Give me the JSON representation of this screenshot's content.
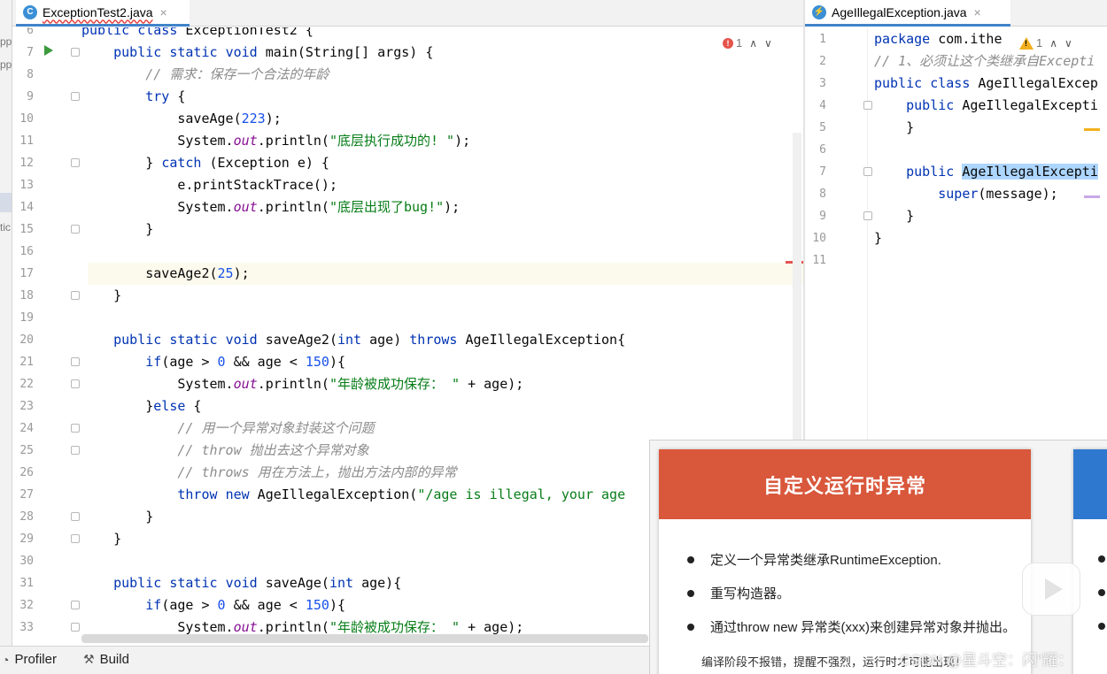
{
  "left_strip": {
    "fragments": [
      "pp",
      "pp",
      "tic"
    ]
  },
  "tabs": {
    "left": {
      "label": "ExceptionTest2.java",
      "icon": "C",
      "close": "×"
    },
    "right": {
      "label": "AgeIllegalException.java",
      "icon": "⚡",
      "close": "×"
    }
  },
  "left_editor": {
    "inspection": {
      "errors": "1"
    },
    "lines": [
      {
        "n": "6",
        "t": "public class ExceptionTest2 {"
      },
      {
        "n": "7",
        "t": "    public static void main(String[] args) {"
      },
      {
        "n": "8",
        "t": "        // 需求：保存一个合法的年龄"
      },
      {
        "n": "9",
        "t": "        try {"
      },
      {
        "n": "10",
        "t": "            saveAge(223);"
      },
      {
        "n": "11",
        "t": "            System.out.println(\"底层执行成功的! \");"
      },
      {
        "n": "12",
        "t": "        } catch (Exception e) {"
      },
      {
        "n": "13",
        "t": "            e.printStackTrace();"
      },
      {
        "n": "14",
        "t": "            System.out.println(\"底层出现了bug!\");"
      },
      {
        "n": "15",
        "t": "        }"
      },
      {
        "n": "16",
        "t": ""
      },
      {
        "n": "17",
        "t": "        saveAge2(25);"
      },
      {
        "n": "18",
        "t": "    }"
      },
      {
        "n": "19",
        "t": ""
      },
      {
        "n": "20",
        "t": "    public static void saveAge2(int age) throws AgeIllegalException{"
      },
      {
        "n": "21",
        "t": "        if(age > 0 && age < 150){"
      },
      {
        "n": "22",
        "t": "            System.out.println(\"年龄被成功保存： \" + age);"
      },
      {
        "n": "23",
        "t": "        }else {"
      },
      {
        "n": "24",
        "t": "            // 用一个异常对象封装这个问题"
      },
      {
        "n": "25",
        "t": "            // throw 抛出去这个异常对象"
      },
      {
        "n": "26",
        "t": "            // throws 用在方法上，抛出方法内部的异常"
      },
      {
        "n": "27",
        "t": "            throw new AgeIllegalException(\"/age is illegal, your age"
      },
      {
        "n": "28",
        "t": "        }"
      },
      {
        "n": "29",
        "t": "    }"
      },
      {
        "n": "30",
        "t": ""
      },
      {
        "n": "31",
        "t": "    public static void saveAge(int age){"
      },
      {
        "n": "32",
        "t": "        if(age > 0 && age < 150){"
      },
      {
        "n": "33",
        "t": "            System.out.println(\"年龄被成功保存： \" + age);"
      }
    ]
  },
  "right_editor": {
    "inspection": {
      "warnings": "1"
    },
    "lines": [
      {
        "n": "1",
        "t": "package com.ithe"
      },
      {
        "n": "2",
        "t": "// 1、必须让这个类继承自Excepti"
      },
      {
        "n": "3",
        "t": "public class AgeIllegalExcep"
      },
      {
        "n": "4",
        "t": "    public AgeIllegalExcepti"
      },
      {
        "n": "5",
        "t": "    }"
      },
      {
        "n": "6",
        "t": ""
      },
      {
        "n": "7",
        "t": "    public AgeIllegalExcepti"
      },
      {
        "n": "8",
        "t": "        super(message);"
      },
      {
        "n": "9",
        "t": "    }"
      },
      {
        "n": "10",
        "t": "}"
      },
      {
        "n": "11",
        "t": ""
      }
    ]
  },
  "statusbar": {
    "profiler": "Profiler",
    "build": "Build"
  },
  "slide": {
    "title": "自定义运行时异常",
    "bullets": [
      "定义一个异常类继承RuntimeException.",
      "重写构造器。",
      "通过throw new 异常类(xxx)来创建异常对象并抛出。"
    ],
    "note": "编译阶段不报错，提醒不强烈，运行时才可能出现！",
    "watermark": "CSDN @星斗空：闪\"耀："
  },
  "colors": {
    "keyword": "#0033b3",
    "comment": "#8c8c8c",
    "string": "#067d17",
    "number": "#1750eb",
    "field": "#871094",
    "slide_header": "#d9573b",
    "slide_header_2": "#2f78d0"
  }
}
